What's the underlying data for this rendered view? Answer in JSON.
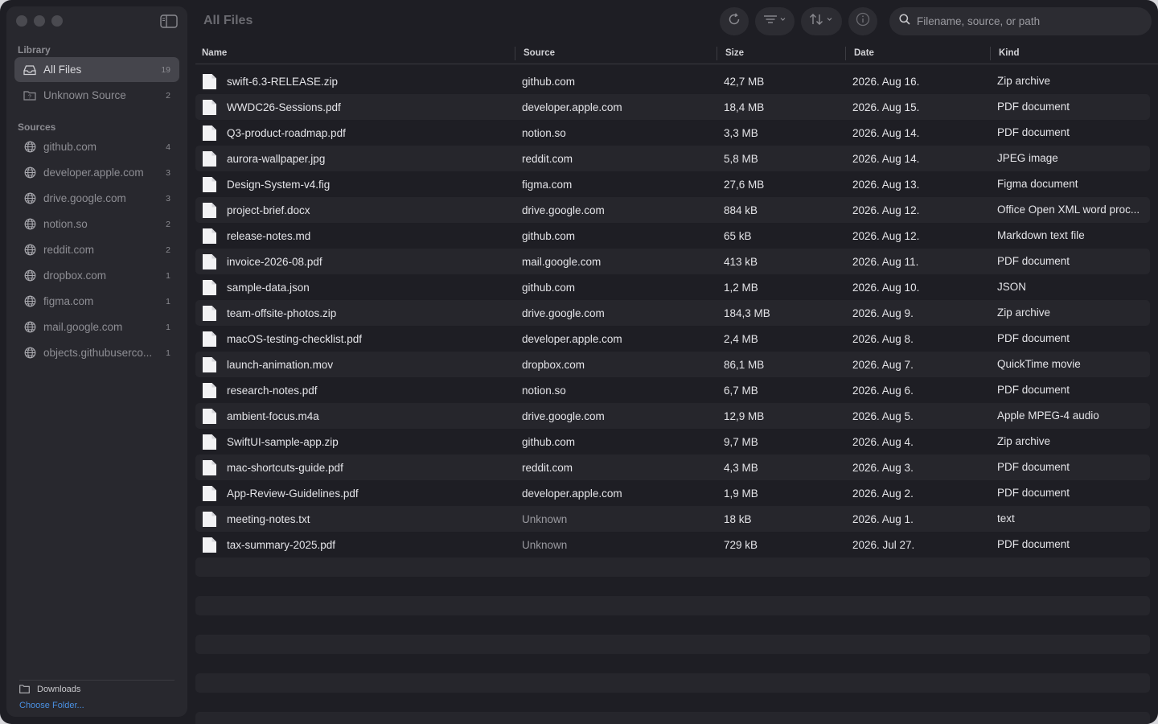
{
  "window": {
    "title": "All Files"
  },
  "sidebar": {
    "library_label": "Library",
    "library_items": [
      {
        "label": "All Files",
        "count": "19",
        "icon": "tray-icon",
        "active": true
      },
      {
        "label": "Unknown Source",
        "count": "2",
        "icon": "question-folder-icon",
        "active": false
      }
    ],
    "sources_label": "Sources",
    "sources": [
      {
        "label": "github.com",
        "count": "4"
      },
      {
        "label": "developer.apple.com",
        "count": "3"
      },
      {
        "label": "drive.google.com",
        "count": "3"
      },
      {
        "label": "notion.so",
        "count": "2"
      },
      {
        "label": "reddit.com",
        "count": "2"
      },
      {
        "label": "dropbox.com",
        "count": "1"
      },
      {
        "label": "figma.com",
        "count": "1"
      },
      {
        "label": "mail.google.com",
        "count": "1"
      },
      {
        "label": "objects.githubuserco...",
        "count": "1"
      }
    ],
    "footer": {
      "folder_label": "Downloads",
      "choose_label": "Choose Folder..."
    }
  },
  "toolbar": {
    "icons": [
      "refresh-icon",
      "filter-icon",
      "sort-icon",
      "info-icon"
    ],
    "search_placeholder": "Filename, source, or path"
  },
  "table": {
    "columns": [
      "Name",
      "Source",
      "Size",
      "Date",
      "Kind"
    ],
    "rows": [
      {
        "name": "swift-6.3-RELEASE.zip",
        "source": "github.com",
        "size": "42,7 MB",
        "date": "2026. Aug 16.",
        "kind": "Zip archive"
      },
      {
        "name": "WWDC26-Sessions.pdf",
        "source": "developer.apple.com",
        "size": "18,4 MB",
        "date": "2026. Aug 15.",
        "kind": "PDF document"
      },
      {
        "name": "Q3-product-roadmap.pdf",
        "source": "notion.so",
        "size": "3,3 MB",
        "date": "2026. Aug 14.",
        "kind": "PDF document"
      },
      {
        "name": "aurora-wallpaper.jpg",
        "source": "reddit.com",
        "size": "5,8 MB",
        "date": "2026. Aug 14.",
        "kind": "JPEG image"
      },
      {
        "name": "Design-System-v4.fig",
        "source": "figma.com",
        "size": "27,6 MB",
        "date": "2026. Aug 13.",
        "kind": "Figma document"
      },
      {
        "name": "project-brief.docx",
        "source": "drive.google.com",
        "size": "884 kB",
        "date": "2026. Aug 12.",
        "kind": "Office Open XML word proc..."
      },
      {
        "name": "release-notes.md",
        "source": "github.com",
        "size": "65 kB",
        "date": "2026. Aug 12.",
        "kind": "Markdown text file"
      },
      {
        "name": "invoice-2026-08.pdf",
        "source": "mail.google.com",
        "size": "413 kB",
        "date": "2026. Aug 11.",
        "kind": "PDF document"
      },
      {
        "name": "sample-data.json",
        "source": "github.com",
        "size": "1,2 MB",
        "date": "2026. Aug 10.",
        "kind": "JSON"
      },
      {
        "name": "team-offsite-photos.zip",
        "source": "drive.google.com",
        "size": "184,3 MB",
        "date": "2026. Aug 9.",
        "kind": "Zip archive"
      },
      {
        "name": "macOS-testing-checklist.pdf",
        "source": "developer.apple.com",
        "size": "2,4 MB",
        "date": "2026. Aug 8.",
        "kind": "PDF document"
      },
      {
        "name": "launch-animation.mov",
        "source": "dropbox.com",
        "size": "86,1 MB",
        "date": "2026. Aug 7.",
        "kind": "QuickTime movie"
      },
      {
        "name": "research-notes.pdf",
        "source": "notion.so",
        "size": "6,7 MB",
        "date": "2026. Aug 6.",
        "kind": "PDF document"
      },
      {
        "name": "ambient-focus.m4a",
        "source": "drive.google.com",
        "size": "12,9 MB",
        "date": "2026. Aug 5.",
        "kind": "Apple MPEG-4 audio"
      },
      {
        "name": "SwiftUI-sample-app.zip",
        "source": "github.com",
        "size": "9,7 MB",
        "date": "2026. Aug 4.",
        "kind": "Zip archive"
      },
      {
        "name": "mac-shortcuts-guide.pdf",
        "source": "reddit.com",
        "size": "4,3 MB",
        "date": "2026. Aug 3.",
        "kind": "PDF document"
      },
      {
        "name": "App-Review-Guidelines.pdf",
        "source": "developer.apple.com",
        "size": "1,9 MB",
        "date": "2026. Aug 2.",
        "kind": "PDF document"
      },
      {
        "name": "meeting-notes.txt",
        "source": "Unknown",
        "size": "18 kB",
        "date": "2026. Aug 1.",
        "kind": "text",
        "unknown": true
      },
      {
        "name": "tax-summary-2025.pdf",
        "source": "Unknown",
        "size": "729 kB",
        "date": "2026. Jul 27.",
        "kind": "PDF document",
        "unknown": true
      }
    ]
  }
}
